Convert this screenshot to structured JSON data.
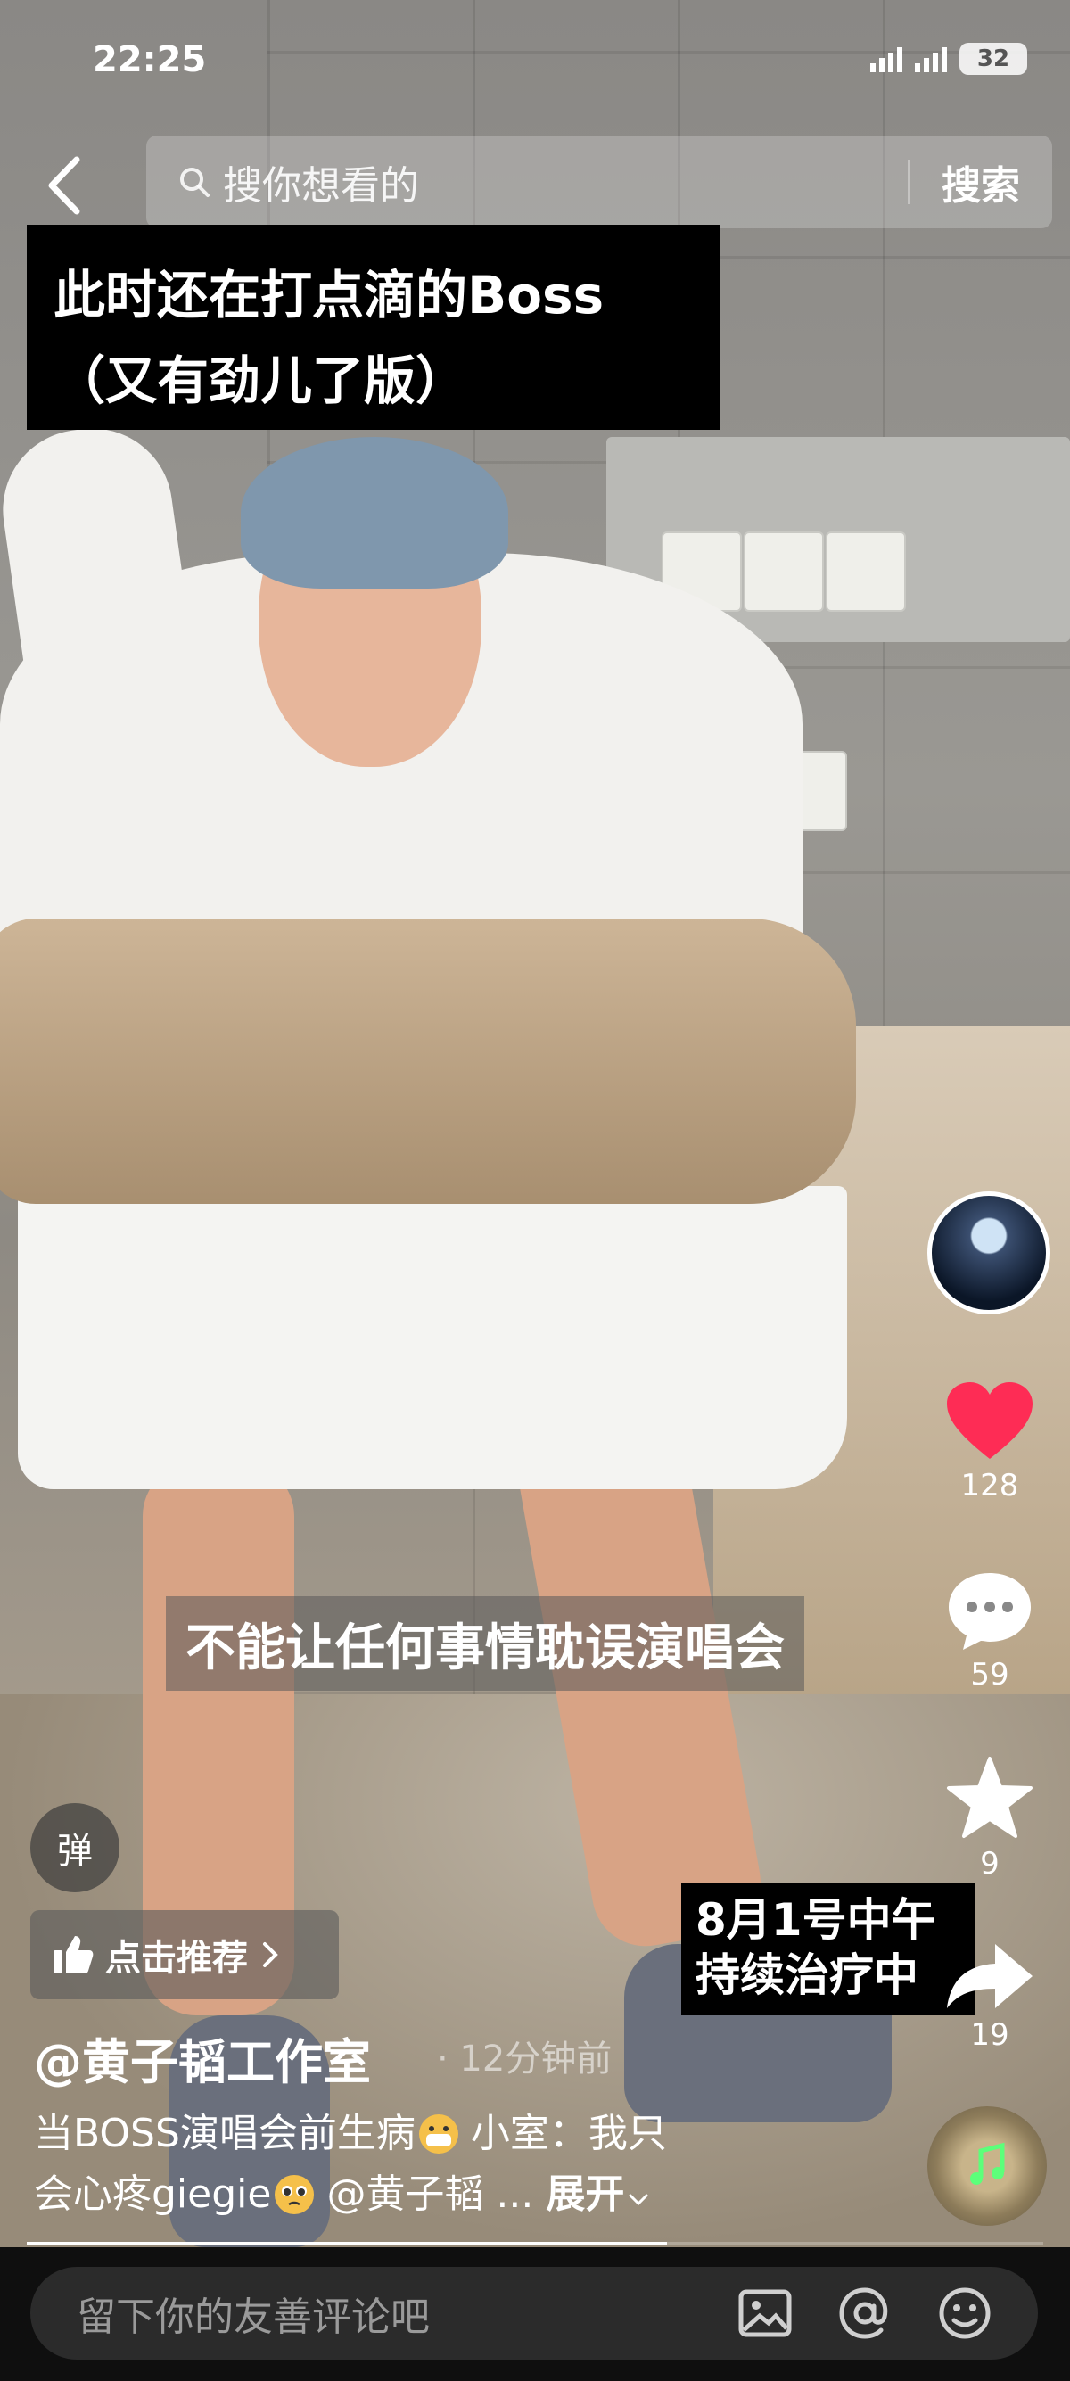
{
  "status_bar": {
    "time": "22:25",
    "battery": "32"
  },
  "search": {
    "placeholder": "搜你想看的",
    "button_label": "搜索"
  },
  "video": {
    "title_line1": "此时还在打点滴的Boss",
    "title_line2": "（又有劲儿了版）",
    "subtitle": "不能让任何事情耽误演唱会",
    "overlay_line1": "8月1号中午",
    "overlay_line2": "持续治疗中"
  },
  "actions": {
    "like_count": "128",
    "comment_count": "59",
    "favorite_count": "9",
    "share_count": "19"
  },
  "controls": {
    "danmu_label": "弹",
    "recommend_label": "点击推荐"
  },
  "post": {
    "author": "@黄子韬工作室",
    "time_ago": "· 12分钟前",
    "description_line1": "当BOSS演唱会前生病",
    "description_line1b": " 小室：我只",
    "description_line2": "会心疼giegie",
    "description_line2b": " @黄子韬 ...",
    "expand_label": "展开",
    "progress": 0.63
  },
  "comment": {
    "placeholder": "留下你的友善评论吧"
  },
  "icons": [
    "back-icon",
    "search-icon",
    "heart-icon",
    "comment-icon",
    "star-icon",
    "share-icon",
    "thumbs-up-icon",
    "image-icon",
    "at-icon",
    "emoji-icon"
  ],
  "colors": {
    "like": "#fe2c55",
    "caption_bg": "#000000",
    "comment_bar": "#0f0f0f"
  }
}
